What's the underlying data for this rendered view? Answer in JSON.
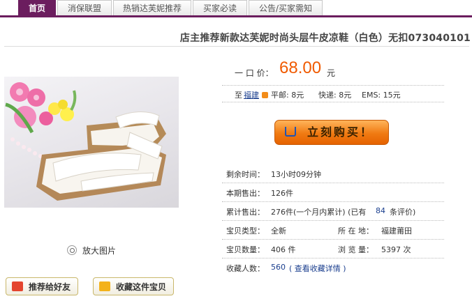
{
  "nav": {
    "tabs": [
      {
        "label": "首页",
        "active": true
      },
      {
        "label": "消保联盟"
      },
      {
        "label": "热销达芙妮推荐"
      },
      {
        "label": "买家必读"
      },
      {
        "label": "公告/买家需知"
      }
    ]
  },
  "product": {
    "title": "店主推荐新款达芙妮时尚头层牛皮凉鞋（白色）无扣073040101",
    "zoom_label": "放大图片",
    "recommend_label": "推荐给好友",
    "favorite_label": "收藏这件宝贝"
  },
  "price": {
    "label": "一 口 价：",
    "value": "68.00",
    "unit": "元"
  },
  "shipping": {
    "to": "至",
    "location": "福建",
    "normal": "平邮: 8元",
    "express": "快递: 8元",
    "ems": "EMS: 15元"
  },
  "buy_button": "立刻购买！",
  "details": {
    "time_left_label": "剩余时间：",
    "time_left": "13小时09分钟",
    "period_sold_label": "本期售出：",
    "period_sold": "126件",
    "total_sold_label": "累计售出：",
    "total_sold": "276件(一个月内累计) (已有",
    "reviews_count": "84",
    "reviews_suffix": "条评价)",
    "condition_label": "宝贝类型：",
    "condition": "全新",
    "location_label": "所 在 地：",
    "location": "福建莆田",
    "quantity_label": "宝贝数量：",
    "quantity": "406 件",
    "views_label": "浏 览 量：",
    "views": "5397 次",
    "favorites_label": "收藏人数：",
    "favorites_count": "560",
    "favorites_link": "( 查看收藏详情 )"
  },
  "colors": {
    "accent": "#6b1d5e",
    "price": "#f05a00",
    "link": "#1a3e8e",
    "buy": "#f07a12"
  }
}
